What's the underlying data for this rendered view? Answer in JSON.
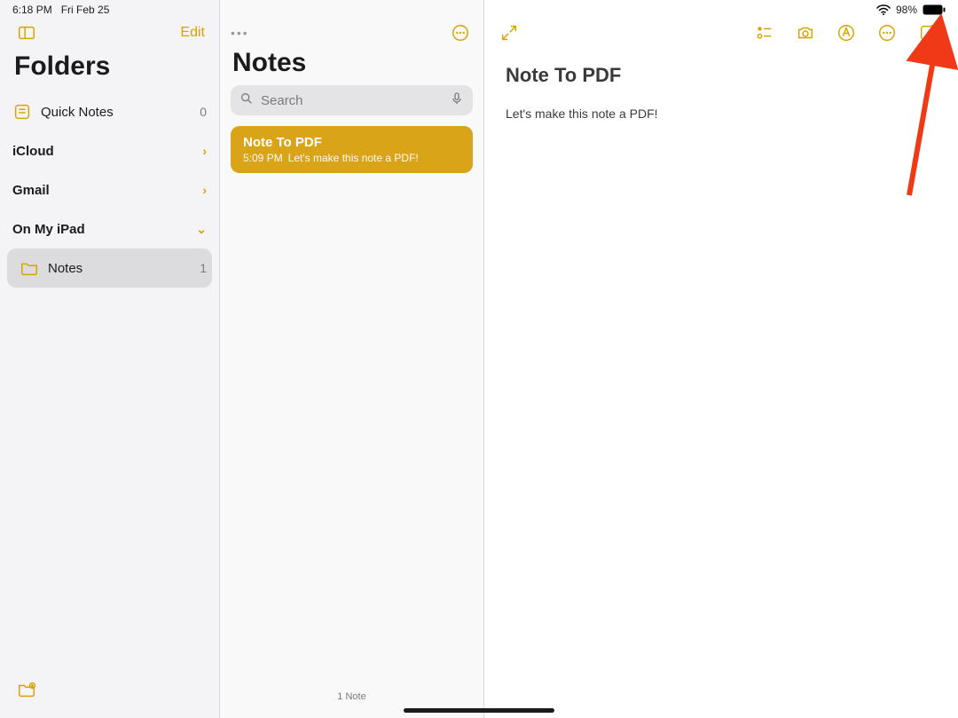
{
  "colors": {
    "accent": "#d6a400",
    "arrow": "#f03a17"
  },
  "status": {
    "time": "6:18 PM",
    "date": "Fri Feb 25",
    "battery_pct": "98%"
  },
  "sidebar": {
    "edit_label": "Edit",
    "title": "Folders",
    "quick_notes": {
      "label": "Quick Notes",
      "count": "0"
    },
    "accounts": [
      {
        "label": "iCloud"
      },
      {
        "label": "Gmail"
      }
    ],
    "local_section": {
      "label": "On My iPad",
      "folders": [
        {
          "label": "Notes",
          "count": "1",
          "selected": true
        }
      ]
    }
  },
  "notes_column": {
    "title": "Notes",
    "search_placeholder": "Search",
    "list": [
      {
        "title": "Note To PDF",
        "time": "5:09 PM",
        "preview": "Let's make this note a PDF!",
        "selected": true
      }
    ],
    "footer": "1 Note"
  },
  "editor": {
    "title": "Note To PDF",
    "body": "Let's make this note a PDF!"
  }
}
